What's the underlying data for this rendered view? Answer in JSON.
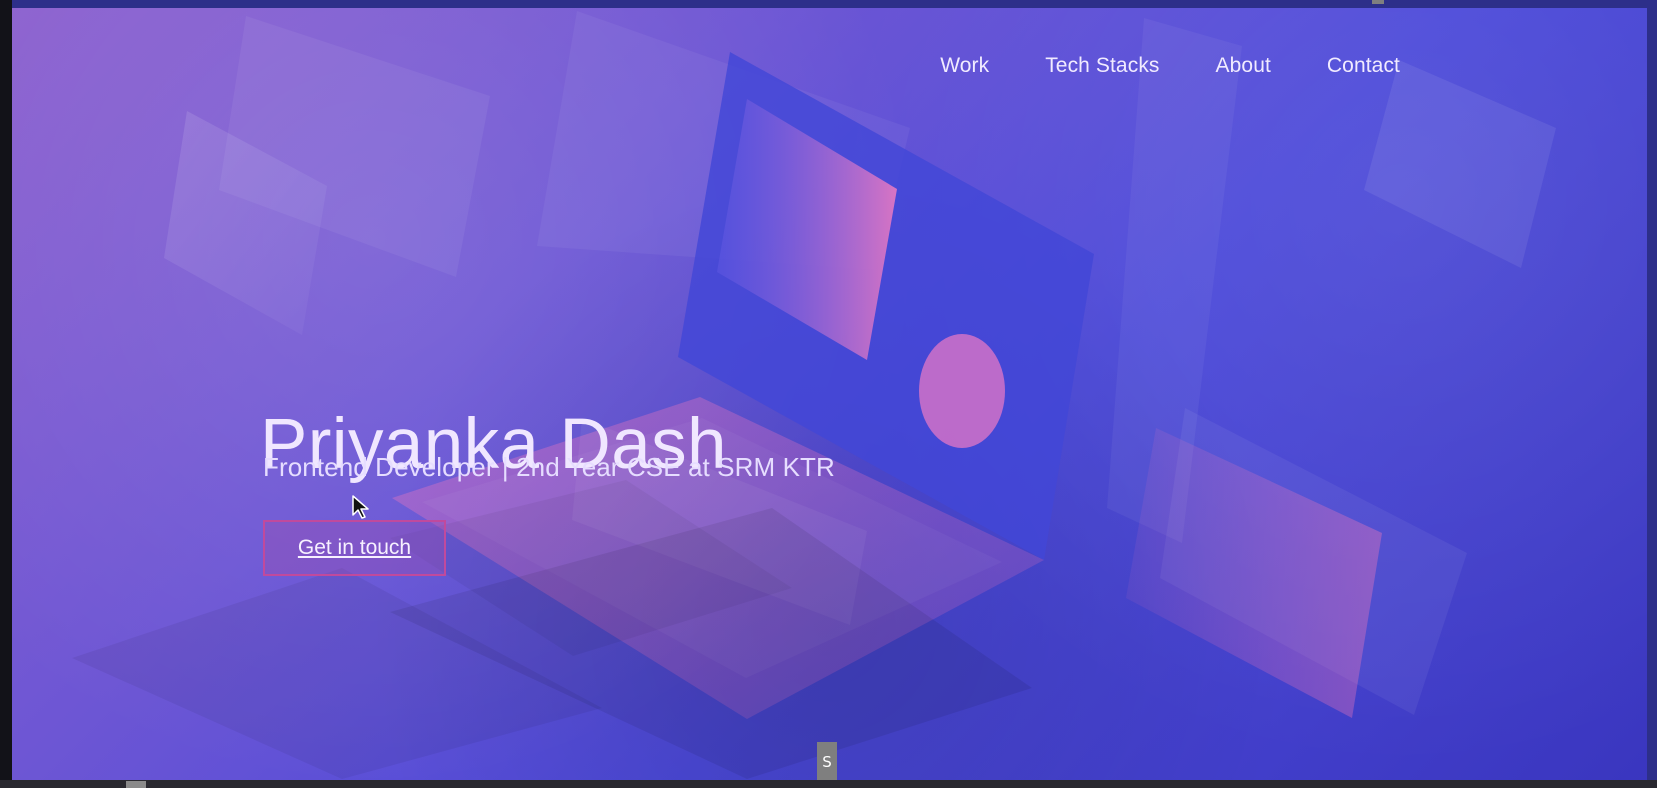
{
  "nav": {
    "items": [
      "Work",
      "Tech Stacks",
      "About",
      "Contact"
    ]
  },
  "hero": {
    "name": "Priyanka Dash",
    "subtitle": "Frontend Developer | 2nd Year CSE at SRM KTR",
    "cta_label": "Get in touch"
  },
  "ui": {
    "scroll_badge": "S"
  },
  "colors": {
    "accent": "#c04a9d",
    "bg_start": "#8c61cf",
    "bg_end": "#3a36bf"
  }
}
